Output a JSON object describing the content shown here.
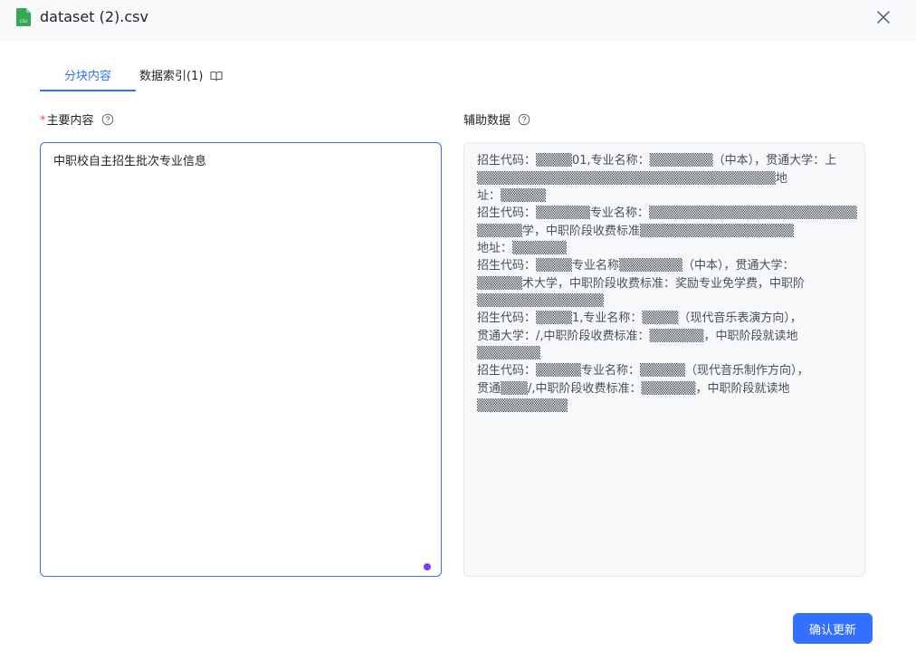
{
  "window": {
    "file_name": "dataset (2).csv",
    "file_icon": "csv-file-icon",
    "file_icon_text": "CSV",
    "close_icon": "close-icon"
  },
  "tabs": [
    {
      "label": "分块内容",
      "active": true
    },
    {
      "label": "数据索引(1)",
      "icon": "book-icon",
      "active": false
    }
  ],
  "main_content": {
    "required_mark": "*",
    "label": "主要内容",
    "value": "中职校自主招生批次专业信息"
  },
  "aux_data": {
    "label": "辅助数据",
    "groups": [
      {
        "lines": [
          "招生代码：▒▒▒▒01,专业名称：▒▒▒▒▒▒▒（中本），贯通大学：上",
          "▒▒▒▒▒▒▒▒▒▒▒▒▒▒▒▒▒▒▒▒▒▒▒▒▒▒▒▒▒▒▒▒▒地",
          "址：▒▒▒▒▒"
        ]
      },
      {
        "lines": [
          "招生代码：▒▒▒▒▒▒专业名称：▒▒▒▒▒▒▒▒▒▒▒▒▒▒▒▒▒▒▒▒▒▒▒",
          "▒▒▒▒▒学，中职阶段收费标准▒▒▒▒▒▒▒▒▒▒▒▒▒▒▒▒▒",
          "地址：▒▒▒▒▒▒"
        ]
      },
      {
        "lines": [
          "招生代码：▒▒▒▒专业名称▒▒▒▒▒▒▒（中本），贯通大学：",
          "▒▒▒▒▒术大学，中职阶段收费标准：奖励专业免学费，中职阶",
          "▒▒▒▒▒▒▒▒▒▒▒▒▒▒"
        ]
      },
      {
        "lines": [
          "招生代码：▒▒▒▒1,专业名称：▒▒▒▒（现代音乐表演方向），",
          "贯通大学：/,中职阶段收费标准：▒▒▒▒▒▒，中职阶段就读地",
          "▒▒▒▒▒▒▒"
        ]
      },
      {
        "lines": [
          "招生代码：▒▒▒▒▒专业名称：▒▒▒▒▒（现代音乐制作方向），",
          "贯通▒▒▒/,中职阶段收费标准：▒▒▒▒▒▒，中职阶段就读地",
          "▒▒▒▒▒▒▒▒▒▒"
        ]
      }
    ]
  },
  "footer": {
    "confirm_label": "确认更新"
  },
  "colors": {
    "accent": "#3370ff",
    "required": "#f54a45",
    "csv_icon": "#34a853"
  }
}
